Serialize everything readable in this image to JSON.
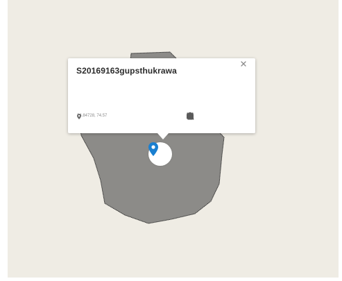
{
  "map": {
    "background_color": "#efece4",
    "polygon_fill": "#8c8b88",
    "polygon_stroke": "#2f2f2f"
  },
  "popup": {
    "title": "S20169163gupsthukrawa",
    "coordinates": "24.84728, 74.57",
    "close_icon": "close-icon",
    "coordinates_icon": "location-pin-icon",
    "actions": [
      {
        "name": "fill-color-icon"
      },
      {
        "name": "edit-pencil-icon"
      },
      {
        "name": "camera-icon"
      },
      {
        "name": "directions-fork-icon"
      },
      {
        "name": "delete-trash-icon"
      }
    ]
  },
  "marker": {
    "icon": "map-marker-icon",
    "color": "#1a7fd0"
  }
}
